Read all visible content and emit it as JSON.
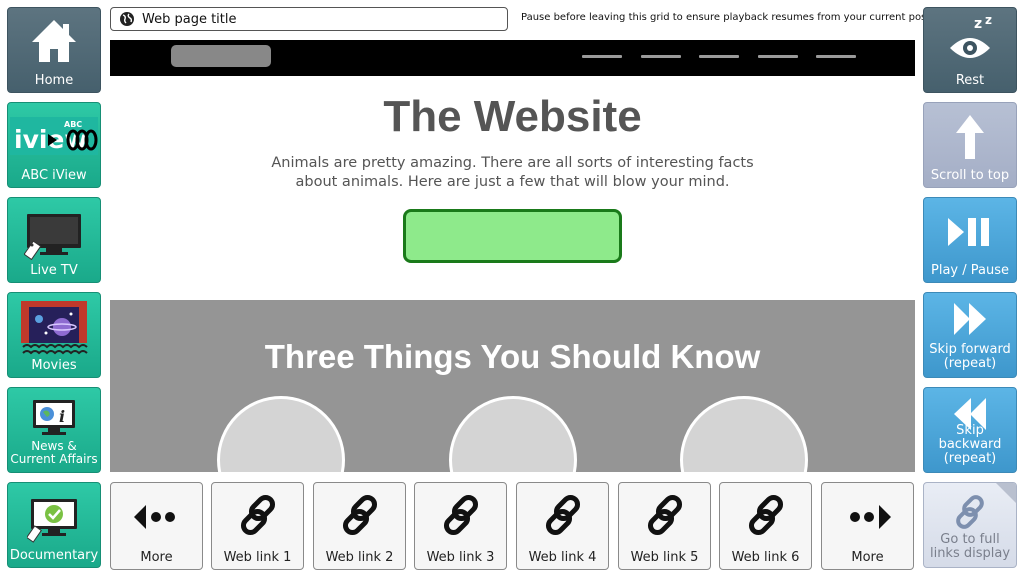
{
  "url_bar": {
    "title": "Web page title"
  },
  "notice": "Pause before leaving this grid to ensure playback resumes from your current position",
  "left_tiles": {
    "home": "Home",
    "abc": "ABC iView",
    "abc_logo_text": "iview",
    "abc_logo_small": "ABC",
    "livetv": "Live TV",
    "movies": "Movies",
    "news": "News & Current Affairs",
    "documentary": "Documentary"
  },
  "right_tiles": {
    "rest": "Rest",
    "scroll": "Scroll to top",
    "play": "Play / Pause",
    "forward": "Skip forward (repeat)",
    "back": "Skip backward (repeat)",
    "links": "Go to full links display"
  },
  "bottom_tiles": {
    "more_left": "More",
    "link1": "Web link 1",
    "link2": "Web link 2",
    "link3": "Web link 3",
    "link4": "Web link 4",
    "link5": "Web link 5",
    "link6": "Web link 6",
    "more_right": "More"
  },
  "webpage": {
    "hero_title": "The Website",
    "hero_text": "Animals are pretty amazing.  There are all sorts of interesting facts about animals.  Here are just a few that will blow your mind.",
    "section_title": "Three Things You Should Know"
  },
  "colors": {
    "teal": "#1fbf9c",
    "slate": "#51697a",
    "blue": "#4aa5d9",
    "grey_section": "#959595",
    "cta_green": "#8eea8b"
  }
}
